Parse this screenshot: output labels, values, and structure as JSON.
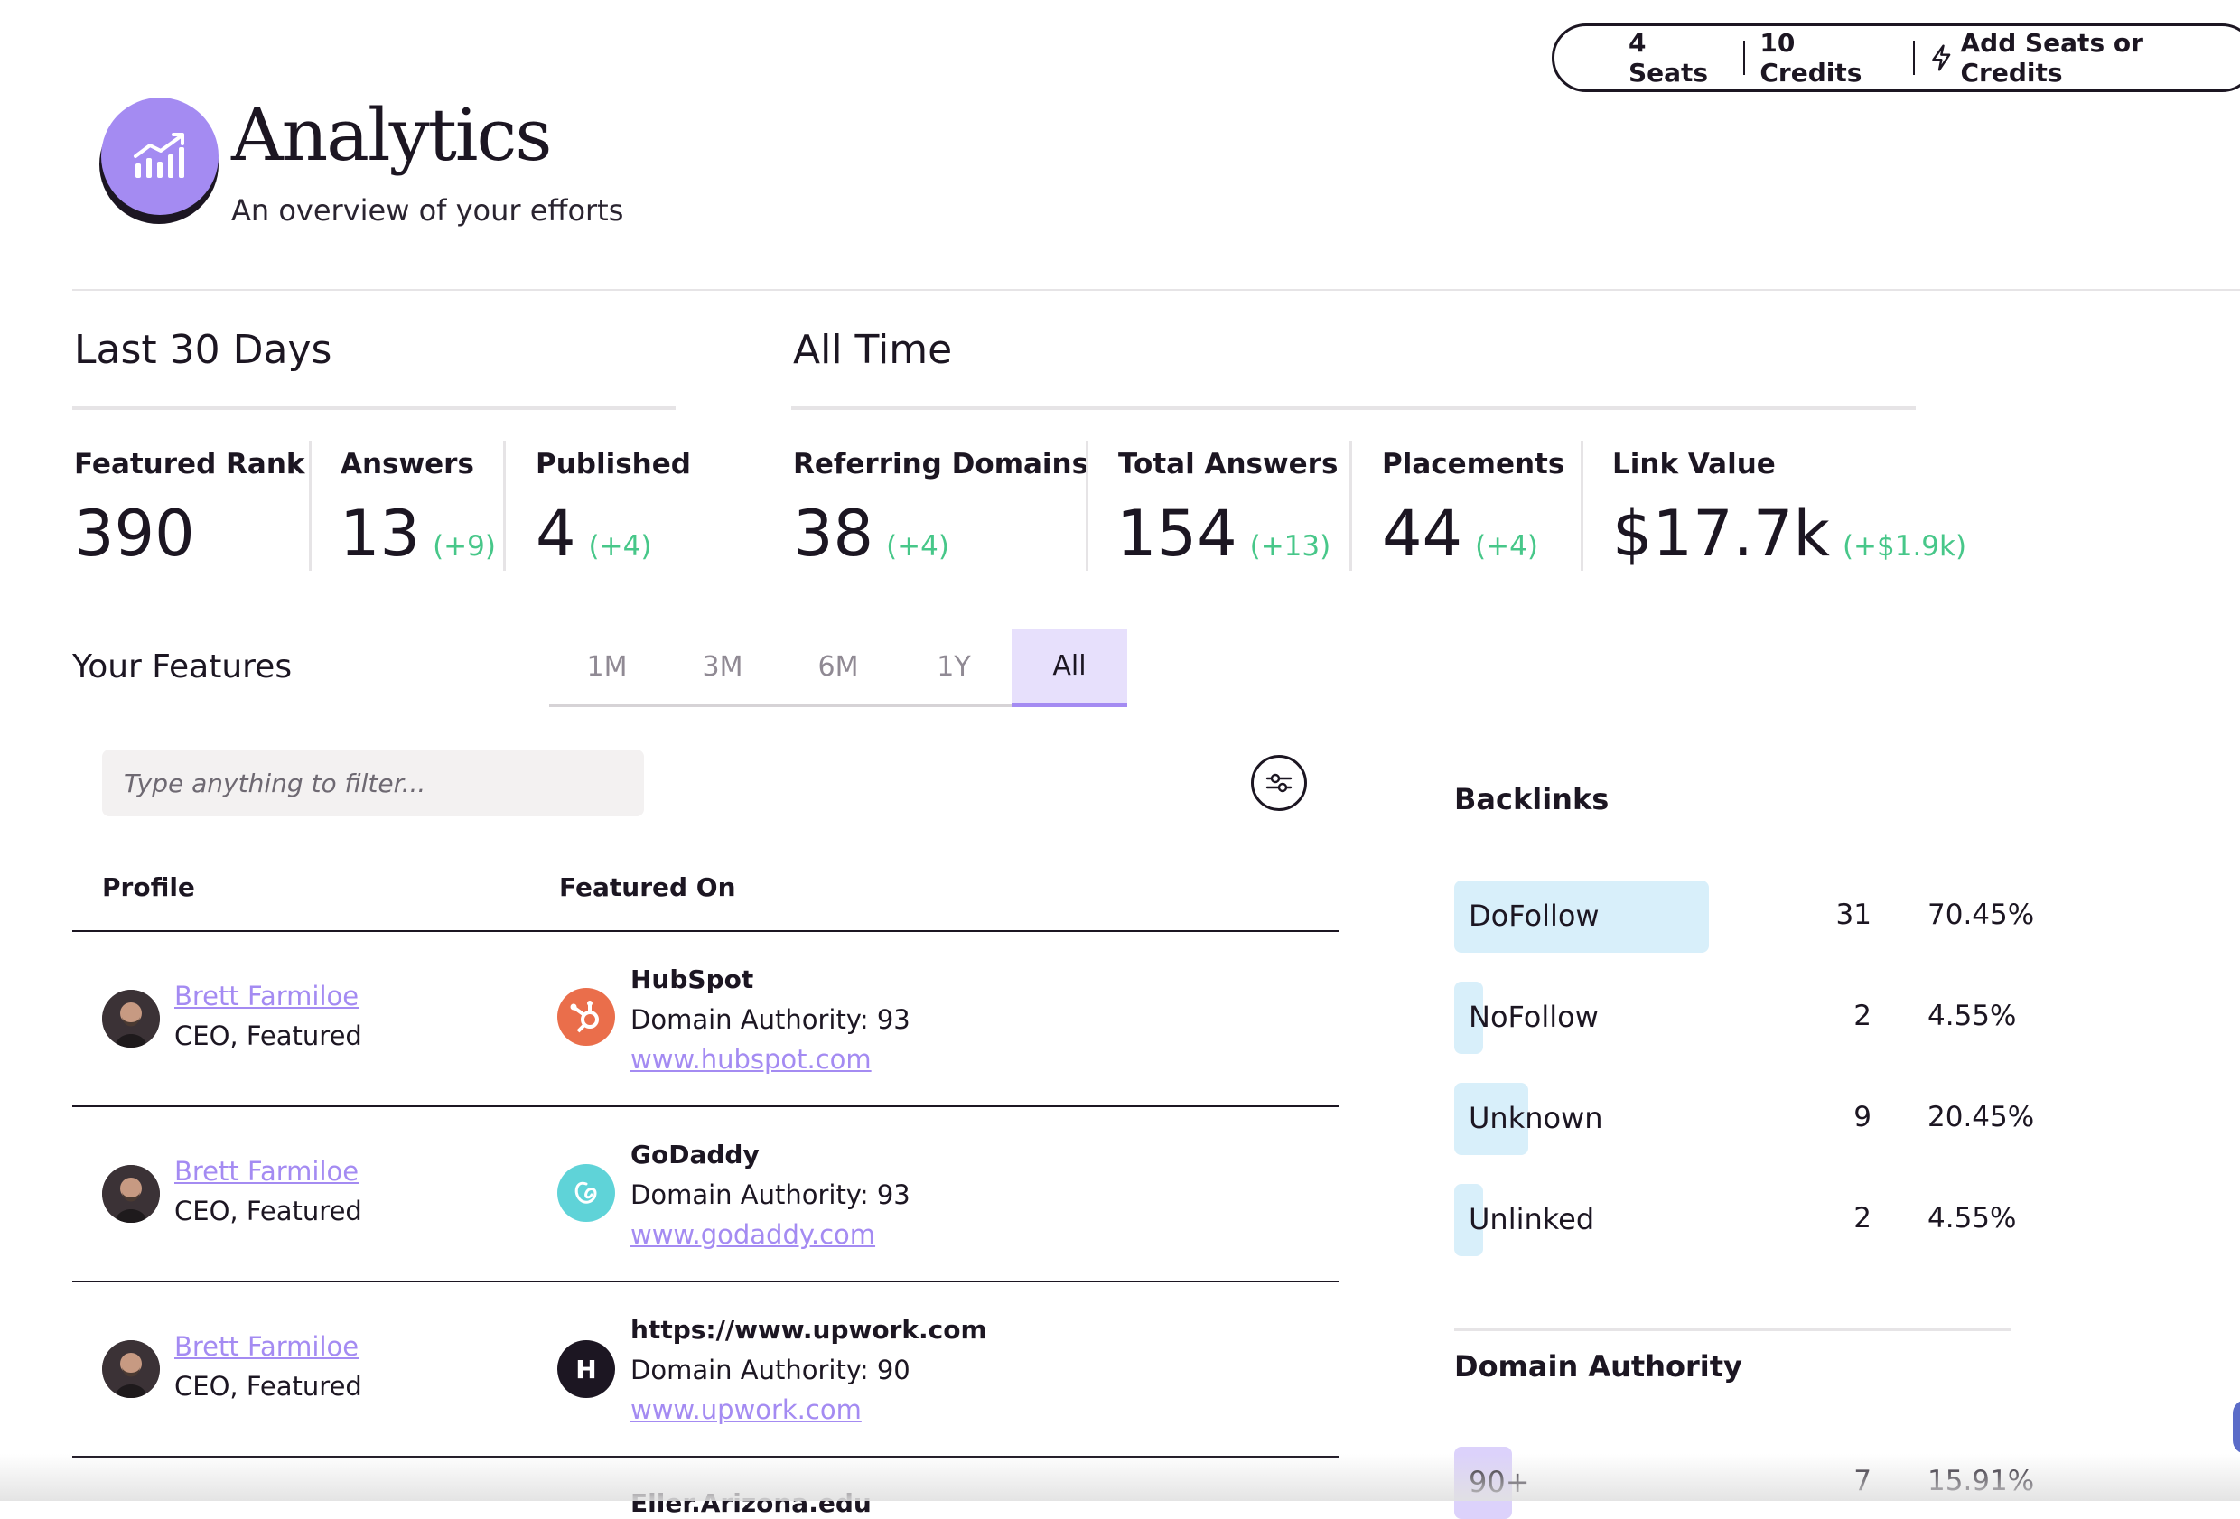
{
  "account": {
    "seats": "4 Seats",
    "credits": "10 Credits",
    "add_label": "Add Seats or Credits",
    "add_icon": "lightning-icon"
  },
  "header": {
    "title": "Analytics",
    "subtitle": "An overview of your efforts",
    "logo_icon": "chart-bars-icon"
  },
  "last30": {
    "title": "Last 30 Days",
    "stats": [
      {
        "label": "Featured Rank",
        "value": "390",
        "delta": ""
      },
      {
        "label": "Answers",
        "value": "13",
        "delta": "(+9)"
      },
      {
        "label": "Published",
        "value": "4",
        "delta": "(+4)"
      }
    ]
  },
  "alltime": {
    "title": "All Time",
    "stats": [
      {
        "label": "Referring Domains",
        "value": "38",
        "delta": "(+4)"
      },
      {
        "label": "Total Answers",
        "value": "154",
        "delta": "(+13)"
      },
      {
        "label": "Placements",
        "value": "44",
        "delta": "(+4)"
      },
      {
        "label": "Link Value",
        "value": "$17.7k",
        "delta": "(+$1.9k)"
      }
    ]
  },
  "features": {
    "title": "Your Features",
    "tabs": [
      "1M",
      "3M",
      "6M",
      "1Y",
      "All"
    ],
    "active_tab": "All",
    "filter_placeholder": "Type anything to filter...",
    "columns": {
      "profile": "Profile",
      "featured_on": "Featured On"
    },
    "rows": [
      {
        "name": "Brett Farmiloe",
        "role": "CEO, Featured",
        "site": "HubSpot",
        "da": "Domain Authority: 93",
        "url": "www.hubspot.com",
        "logo_letter": "",
        "logo_color": "#ea6e4b"
      },
      {
        "name": "Brett Farmiloe",
        "role": "CEO, Featured",
        "site": "GoDaddy",
        "da": "Domain Authority: 93",
        "url": "www.godaddy.com",
        "logo_letter": "",
        "logo_color": "#5fd3d8"
      },
      {
        "name": "Brett Farmiloe",
        "role": "CEO, Featured",
        "site": "https://www.upwork.com",
        "da": "Domain Authority: 90",
        "url": "www.upwork.com",
        "logo_letter": "H",
        "logo_color": "#1c1622"
      },
      {
        "site": "Eller.Arizona.edu"
      }
    ]
  },
  "backlinks": {
    "title": "Backlinks",
    "color": "#d8effa",
    "items": [
      {
        "label": "DoFollow",
        "count": "31",
        "pct": "70.45%",
        "fraction": 0.7045
      },
      {
        "label": "NoFollow",
        "count": "2",
        "pct": "4.55%",
        "fraction": 0.0455
      },
      {
        "label": "Unknown",
        "count": "9",
        "pct": "20.45%",
        "fraction": 0.2045
      },
      {
        "label": "Unlinked",
        "count": "2",
        "pct": "4.55%",
        "fraction": 0.0455
      }
    ]
  },
  "domain_authority": {
    "title": "Domain Authority",
    "color": "#dcd2fb",
    "items": [
      {
        "label": "90+",
        "count": "7",
        "pct": "15.91%",
        "fraction": 0.1591
      }
    ]
  },
  "colors": {
    "accent": "#a48bf2",
    "positive": "#47c789",
    "ink": "#1c1622"
  }
}
